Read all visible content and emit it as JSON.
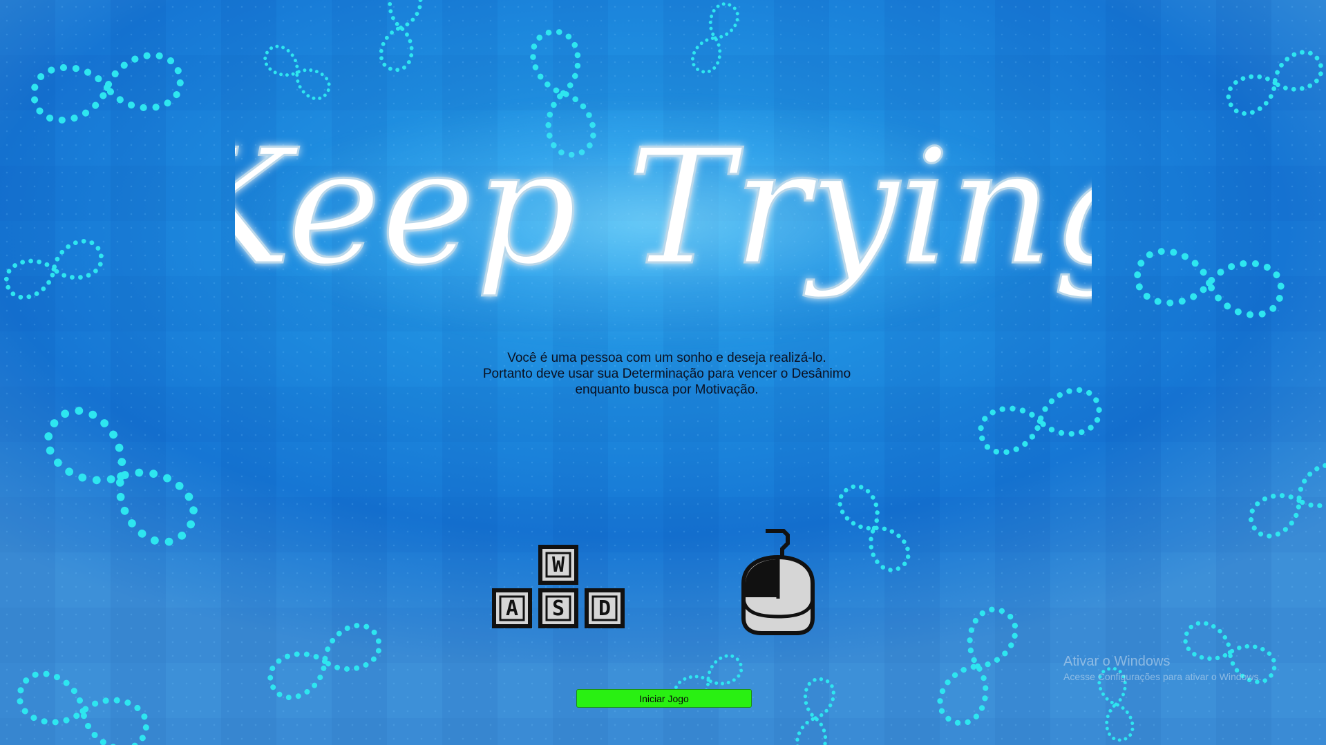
{
  "game": {
    "title": "Keep Trying",
    "description_lines": [
      "Você é uma pessoa com um sonho e deseja realizá-lo.",
      "Portanto deve usar sua Determinação para vencer o Desânimo",
      "enquanto busca por Motivação."
    ],
    "controls": {
      "keys": [
        "W",
        "A",
        "S",
        "D"
      ]
    },
    "start_button_label": "Iniciar Jogo"
  },
  "os_watermark": {
    "title": "Ativar o Windows",
    "subtitle": "Acesse Configurações para ativar o Windows."
  },
  "colors": {
    "background": "#1f8ee0",
    "infinity_dots": "#2ee6f0",
    "title_fill": "#ffffff",
    "button": "#29f012"
  }
}
